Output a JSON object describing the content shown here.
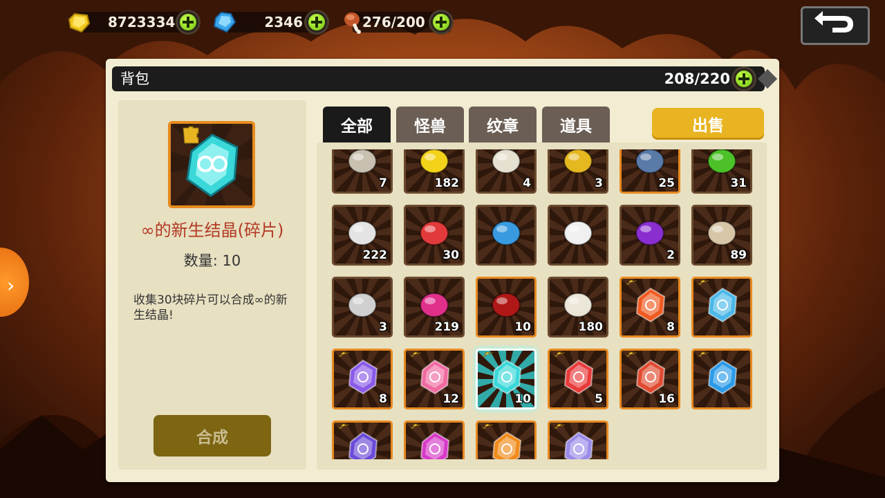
{
  "currency": {
    "gold": {
      "value": "8723334",
      "icon": "gold-gem-icon"
    },
    "diamond": {
      "value": "2346",
      "icon": "blue-diamond-icon"
    },
    "stamina": {
      "value": "276/200",
      "icon": "meat-drumstick-icon"
    }
  },
  "panel": {
    "title": "背包",
    "capacity": "208/220"
  },
  "detail": {
    "item_name": "∞的新生结晶(碎片)",
    "quantity_label": "数量: 10",
    "description": "收集30块碎片可以合成∞的新生结晶!",
    "combine_label": "合成"
  },
  "tabs": [
    {
      "label": "全部",
      "active": true
    },
    {
      "label": "怪兽",
      "active": false
    },
    {
      "label": "纹章",
      "active": false
    },
    {
      "label": "道具",
      "active": false
    }
  ],
  "sell_label": "出售",
  "items": [
    {
      "icon": "fang-jaw-icon",
      "count": "7",
      "rare": false,
      "puzzle": false,
      "color": "#c8c0b0"
    },
    {
      "icon": "gold-coin-pile-icon",
      "count": "182",
      "rare": false,
      "puzzle": false,
      "color": "#f3d21a"
    },
    {
      "icon": "bone-claw-icon",
      "count": "4",
      "rare": false,
      "puzzle": false,
      "color": "#e6e0d0"
    },
    {
      "icon": "gold-ring-icon",
      "count": "3",
      "rare": false,
      "puzzle": false,
      "color": "#e6b820"
    },
    {
      "icon": "dark-crest-icon",
      "count": "25",
      "rare": true,
      "puzzle": false,
      "color": "#5a7aa8"
    },
    {
      "icon": "green-gem-icon",
      "count": "31",
      "rare": false,
      "puzzle": false,
      "color": "#4cc228"
    },
    {
      "icon": "skull-icon",
      "count": "222",
      "rare": false,
      "puzzle": false,
      "color": "#e4e4e4"
    },
    {
      "icon": "red-blob-icon",
      "count": "30",
      "rare": false,
      "puzzle": false,
      "color": "#e23a3a"
    },
    {
      "icon": "double-arrow-icon",
      "count": "",
      "rare": false,
      "puzzle": false,
      "color": "#3a9adf"
    },
    {
      "icon": "eyeball-icon",
      "count": "",
      "rare": false,
      "puzzle": false,
      "color": "#f0f0f0"
    },
    {
      "icon": "purple-fruit-icon",
      "count": "2",
      "rare": false,
      "puzzle": false,
      "color": "#8a2ed0"
    },
    {
      "icon": "scales-icon",
      "count": "89",
      "rare": false,
      "puzzle": false,
      "color": "#d8c6a8"
    },
    {
      "icon": "claws-icon",
      "count": "3",
      "rare": false,
      "puzzle": false,
      "color": "#d0d0d0"
    },
    {
      "icon": "pink-heart-icon",
      "count": "219",
      "rare": false,
      "puzzle": false,
      "color": "#e0308a"
    },
    {
      "icon": "red-spike-orb-icon",
      "count": "10",
      "rare": true,
      "puzzle": false,
      "color": "#b01818"
    },
    {
      "icon": "horn-icon",
      "count": "180",
      "rare": false,
      "puzzle": false,
      "color": "#ece6d8"
    },
    {
      "icon": "fire-crystal-fragment-icon",
      "count": "8",
      "rare": true,
      "puzzle": true,
      "color": "#f05a20"
    },
    {
      "icon": "ice-crystal-fragment-icon",
      "count": "",
      "rare": true,
      "puzzle": true,
      "color": "#4ab8e8"
    },
    {
      "icon": "violet-crystal-fragment-icon",
      "count": "8",
      "rare": true,
      "puzzle": true,
      "color": "#8a5ae8"
    },
    {
      "icon": "pink-crystal-fragment-icon",
      "count": "12",
      "rare": true,
      "puzzle": true,
      "color": "#f06aa0"
    },
    {
      "icon": "infinity-crystal-fragment-icon",
      "count": "10",
      "rare": true,
      "puzzle": true,
      "color": "#3ad8d8",
      "selected": true
    },
    {
      "icon": "red-crystal-fragment-icon",
      "count": "5",
      "rare": true,
      "puzzle": true,
      "color": "#e83a3a"
    },
    {
      "icon": "crimson-crystal-fragment-icon",
      "count": "16",
      "rare": true,
      "puzzle": true,
      "color": "#e04a30"
    },
    {
      "icon": "blue-crystal-fragment-icon",
      "count": "",
      "rare": true,
      "puzzle": true,
      "color": "#2a9ae8"
    },
    {
      "icon": "purple-crystal-fragment-icon",
      "count": "",
      "rare": true,
      "puzzle": true,
      "color": "#6a4ad8"
    },
    {
      "icon": "magenta-crystal-fragment-icon",
      "count": "",
      "rare": true,
      "puzzle": true,
      "color": "#d83ac8"
    },
    {
      "icon": "flame-crystal-fragment-icon",
      "count": "",
      "rare": true,
      "puzzle": true,
      "color": "#f08a1a"
    },
    {
      "icon": "silver-crystal-fragment-icon",
      "count": "",
      "rare": true,
      "puzzle": true,
      "color": "#9a8ae8"
    }
  ]
}
